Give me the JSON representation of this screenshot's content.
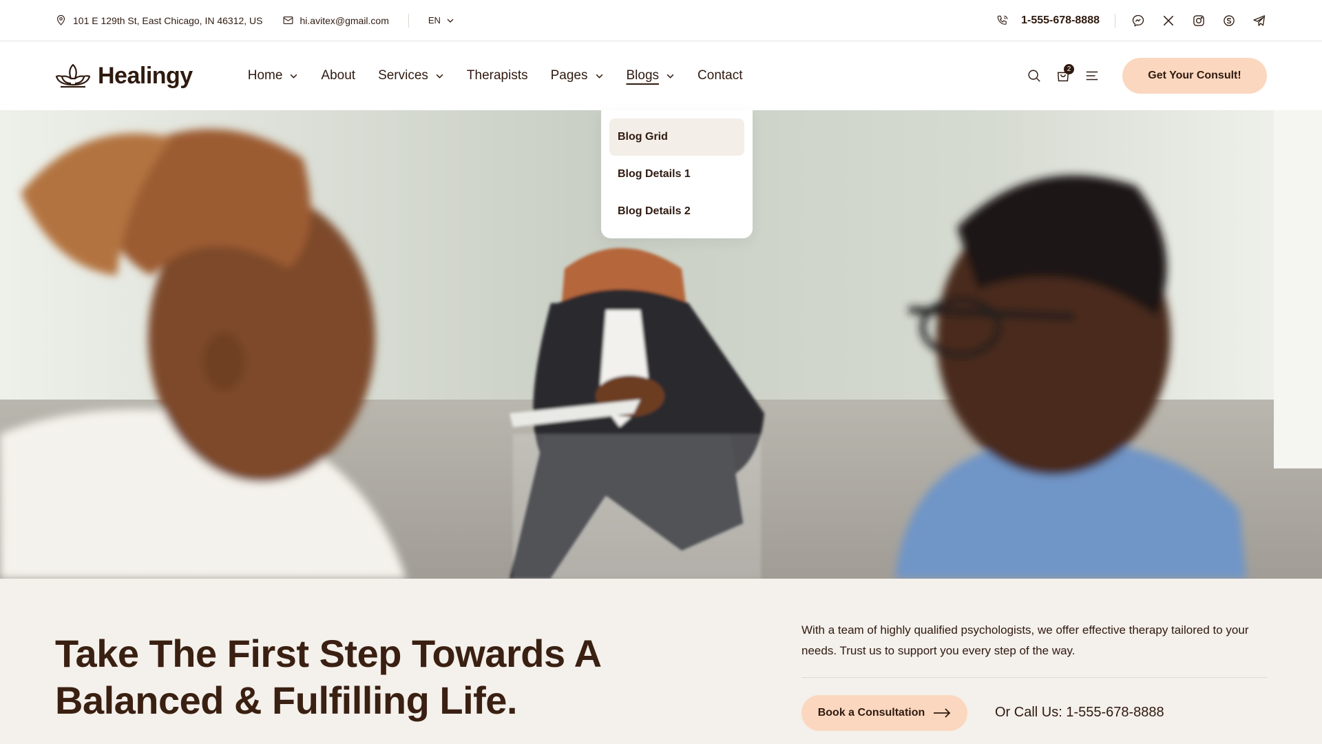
{
  "topbar": {
    "address": "101 E 129th St, East Chicago, IN 46312, US",
    "email": "hi.avitex@gmail.com",
    "language": "EN",
    "phone": "1-555-678-8888",
    "socials": [
      "messenger-icon",
      "x-icon",
      "instagram-icon",
      "skype-icon",
      "telegram-icon"
    ]
  },
  "header": {
    "logo_text": "Healingy",
    "nav": [
      {
        "label": "Home",
        "has_dropdown": true
      },
      {
        "label": "About",
        "has_dropdown": false
      },
      {
        "label": "Services",
        "has_dropdown": true
      },
      {
        "label": "Therapists",
        "has_dropdown": false
      },
      {
        "label": "Pages",
        "has_dropdown": true
      },
      {
        "label": "Blogs",
        "has_dropdown": true,
        "active": true
      },
      {
        "label": "Contact",
        "has_dropdown": false
      }
    ],
    "cart_count": "2",
    "cta_label": "Get Your Consult!"
  },
  "blogs_dropdown": {
    "items": [
      "Blog Grid",
      "Blog Details 1",
      "Blog Details 2"
    ],
    "highlighted": "Blog Grid"
  },
  "hero": {
    "headline_line1": "Take The First Step Towards A",
    "headline_line2": "Balanced & Fulfilling Life.",
    "description": "With a team of highly qualified psychologists, we offer effective therapy tailored to your needs. Trust us to support you every step of the way.",
    "book_label": "Book a Consultation",
    "call_text": "Or Call Us: 1-555-678-8888"
  },
  "colors": {
    "primary_text": "#2f1a10",
    "accent_peach": "#fbd7bf",
    "section_bg": "#f4f0eb",
    "dropdown_highlight": "#f3eee8"
  }
}
